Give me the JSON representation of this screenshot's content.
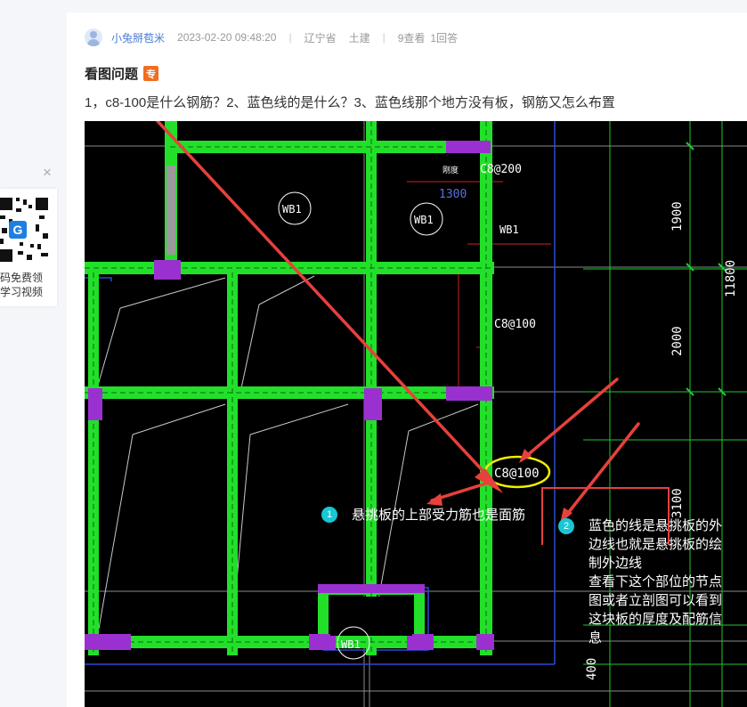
{
  "post": {
    "username": "小兔掰苞米",
    "datetime": "2023-02-20 09:48:20",
    "separator": "|",
    "region": "辽宁省",
    "category": "土建",
    "views": "9查看",
    "answers": "1回答",
    "title": "看图问题",
    "badge": "专",
    "question": "1，c8-100是什么钢筋？2、蓝色线的是什么？3、蓝色线那个地方没有板，钢筋又怎么布置"
  },
  "side_panel": {
    "line1": "码免费领",
    "line2": "学习视频",
    "close": "×"
  },
  "drawing": {
    "labels": {
      "wb1_a": "WB1",
      "wb1_b": "WB1",
      "wb1_c": "WB1",
      "wb1_d": "WB1",
      "rebar_top": "C8@200",
      "dim_1300": "1300",
      "small_label": "刚度",
      "rebar_mid": "C8@100",
      "rebar_circled": "C8@100",
      "dim_1900": "1900",
      "dim_2000": "2000",
      "dim_3100": "3100",
      "dim_11800": "11800",
      "dim_400": "400"
    },
    "annotations": {
      "num1": "1",
      "text1": "悬挑板的上部受力筋也是面筋",
      "num2": "2",
      "text2": [
        "蓝色的线是悬挑板的外",
        "边线也就是悬挑板的绘",
        "制外边线",
        "查看下这个部位的节点",
        "图或者立剖图可以看到",
        "这块板的厚度及配筋信",
        "息"
      ]
    }
  },
  "colors": {
    "beam": "#22e02a",
    "column": "#9b30d0",
    "arrow": "#e8403c",
    "blue_line": "#2c4ad6",
    "highlight": "#f0f000",
    "badge": "#f36c21",
    "number_circle": "#19c6d6"
  }
}
